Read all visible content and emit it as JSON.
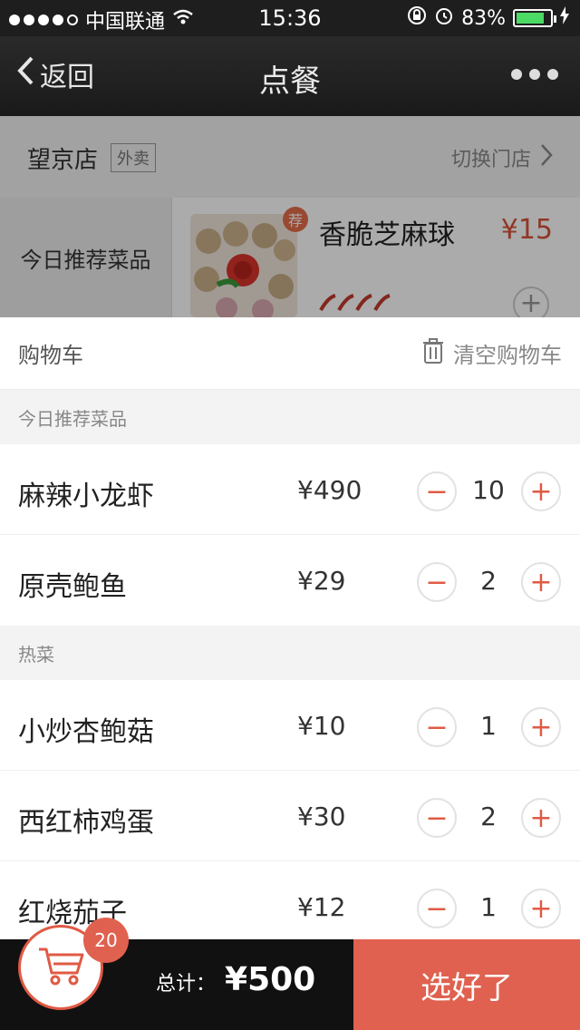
{
  "status": {
    "carrier": "中国联通",
    "time": "15:36",
    "battery": "83%"
  },
  "nav": {
    "back": "返回",
    "title": "点餐"
  },
  "store": {
    "name": "望京店",
    "tag": "外卖",
    "switch": "切换门店"
  },
  "background": {
    "category": "今日推荐菜品",
    "badge": "荐",
    "dish_name": "香脆芝麻球",
    "dish_price": "¥15"
  },
  "cart": {
    "title": "购物车",
    "clear": "清空购物车",
    "sections": [
      {
        "title": "今日推荐菜品",
        "items": [
          {
            "name": "麻辣小龙虾",
            "price": "¥490",
            "qty": "10"
          },
          {
            "name": "原壳鲍鱼",
            "price": "¥29",
            "qty": "2"
          }
        ]
      },
      {
        "title": "热菜",
        "items": [
          {
            "name": "小炒杏鲍菇",
            "price": "¥10",
            "qty": "1"
          },
          {
            "name": "西红柿鸡蛋",
            "price": "¥30",
            "qty": "2"
          },
          {
            "name": "红烧茄子",
            "price": "¥12",
            "qty": "1"
          }
        ]
      }
    ]
  },
  "bottom": {
    "cart_count": "20",
    "total_label": "总计：",
    "total_amount": "¥500",
    "confirm": "选好了"
  },
  "colors": {
    "accent": "#e0614f",
    "price_red": "#d9533a"
  },
  "icons": {
    "back": "chevron-left-icon",
    "more": "more-dots-icon",
    "trash": "trash-icon",
    "cart": "cart-icon"
  }
}
